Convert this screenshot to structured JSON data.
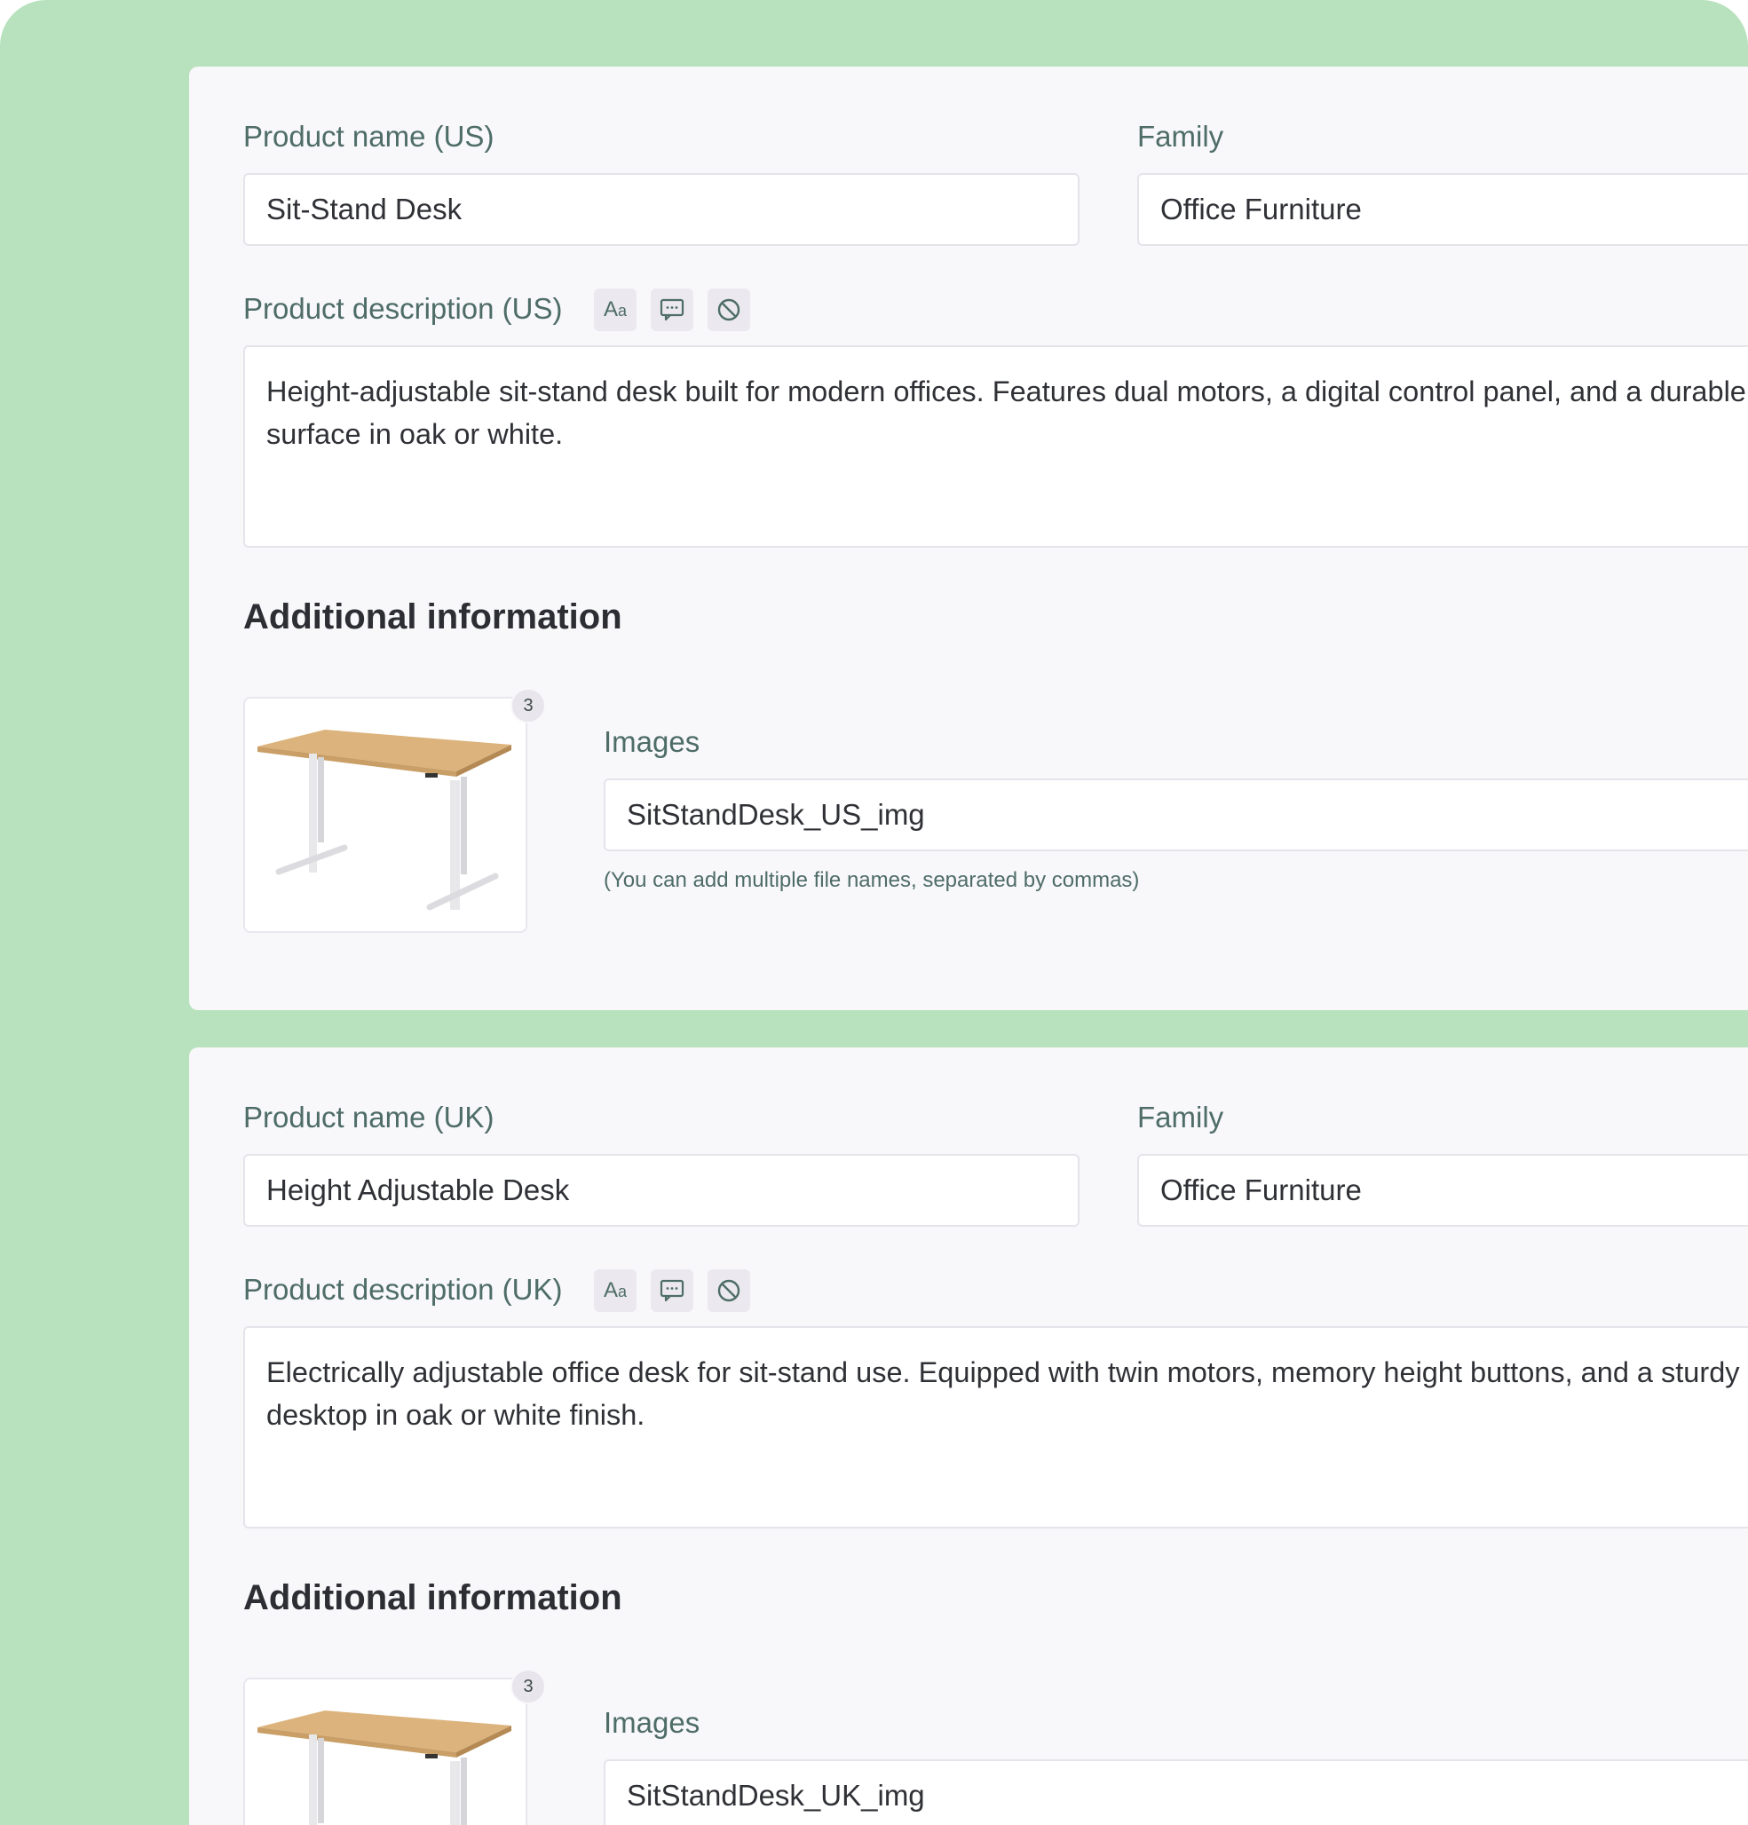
{
  "us": {
    "name_label": "Product name (US)",
    "name_value": "Sit-Stand Desk",
    "family_label": "Family",
    "family_value": "Office Furniture",
    "desc_label": "Product description (US)",
    "desc_value": "Height-adjustable sit-stand desk built for modern offices. Features dual motors, a digital control panel, and a durable surface in oak or white.",
    "section_title": "Additional information",
    "image_count": "3",
    "images_label": "Images",
    "images_value": "SitStandDesk_US_img",
    "images_hint": "(You can add multiple file names, separated by commas)"
  },
  "uk": {
    "name_label": "Product name (UK)",
    "name_value": "Height Adjustable Desk",
    "family_label": "Family",
    "family_value": "Office Furniture",
    "desc_label": "Product description (UK)",
    "desc_value": "Electrically adjustable office desk for sit-stand use. Equipped with twin motors, memory height buttons, and a sturdy desktop in oak or white finish.",
    "section_title": "Additional information",
    "image_count": "3",
    "images_label": "Images",
    "images_value": "SitStandDesk_UK_img"
  },
  "icons": [
    "text-format-icon",
    "comment-icon",
    "disable-icon"
  ],
  "colors": {
    "background": "#b8e2bd",
    "panel": "#f8f7fa",
    "label": "#4e6d66",
    "text": "#2f3136"
  }
}
